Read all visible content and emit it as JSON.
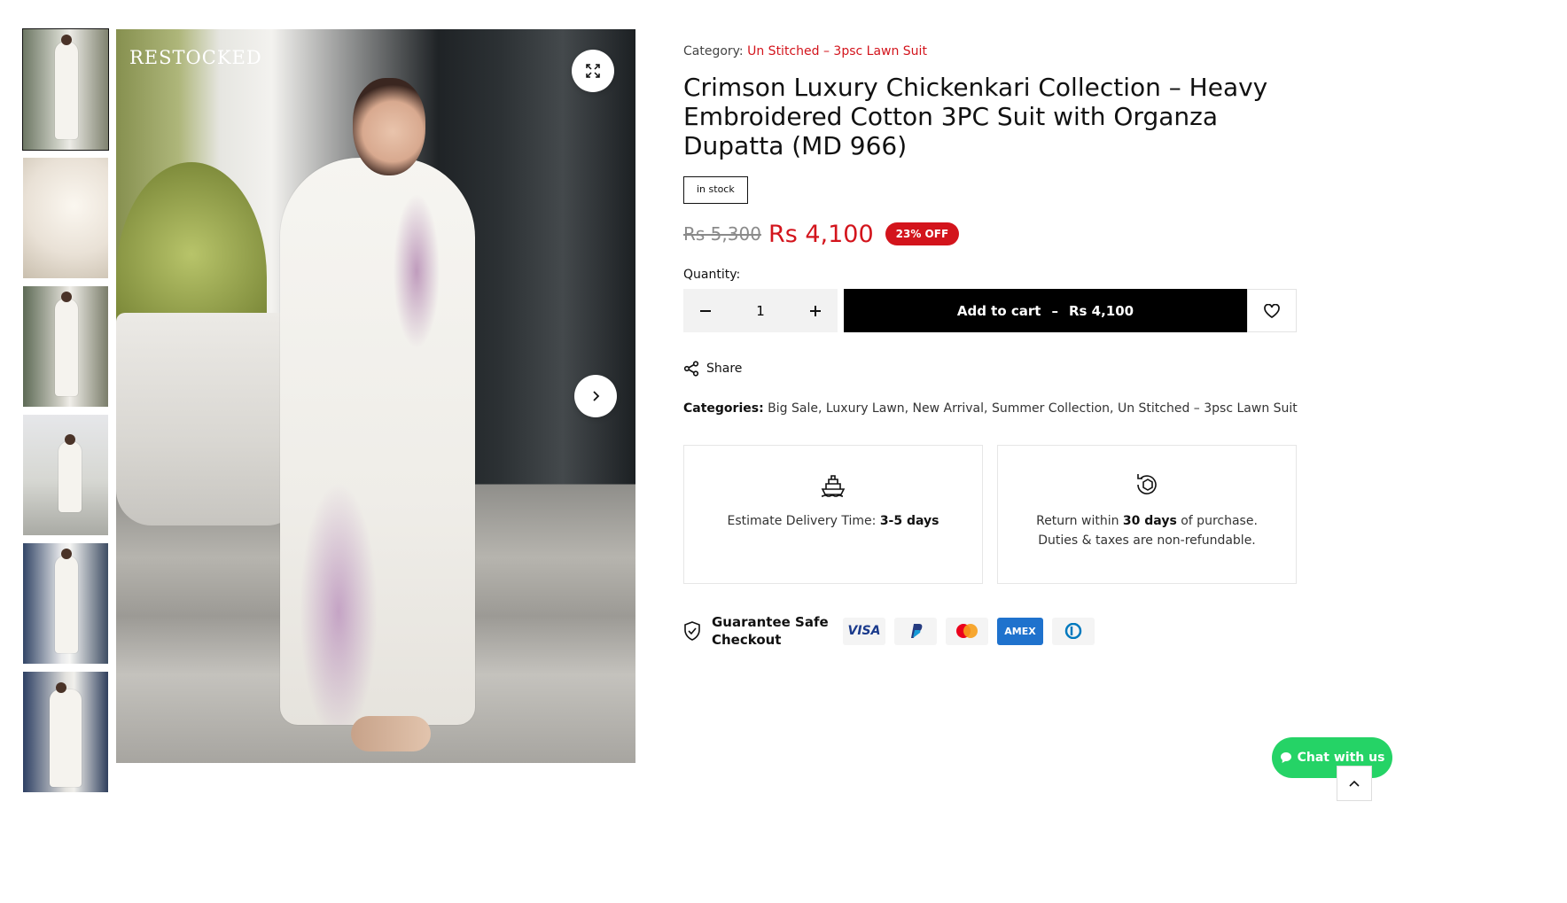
{
  "gallery": {
    "watermark": "RESTOCKED",
    "thumbnails": [
      {
        "active": true
      },
      {
        "active": false
      },
      {
        "active": false
      },
      {
        "active": false
      },
      {
        "active": false
      },
      {
        "active": false
      }
    ],
    "zoom_icon": "expand-icon",
    "next_icon": "chevron-right-icon"
  },
  "product": {
    "category_label": "Category:",
    "category_link": "Un Stitched – 3psc Lawn Suit",
    "title": "Crimson Luxury Chickenkari Collection – Heavy Embroidered Cotton 3PC Suit with Organza Dupatta (MD 966)",
    "stock": "in stock",
    "price_old": "Rs 5,300",
    "price_new": "Rs 4,100",
    "discount": "23% OFF",
    "quantity_label": "Quantity:",
    "quantity": "1",
    "add_to_cart_label": "Add to cart",
    "add_to_cart_sep": "–",
    "add_to_cart_price": "Rs 4,100",
    "share_label": "Share",
    "categories_label": "Categories:",
    "categories": [
      "Big Sale",
      "Luxury Lawn",
      "New Arrival",
      "Summer Collection",
      "Un Stitched – 3psc Lawn Suit"
    ]
  },
  "features": {
    "delivery_prefix": "Estimate Delivery Time:",
    "delivery_value": "3-5 days",
    "return_prefix": "Return within",
    "return_value": "30 days",
    "return_suffix": "of purchase. Duties & taxes are non-refundable."
  },
  "checkout": {
    "label": "Guarantee Safe Checkout",
    "payments": [
      "VISA",
      "PayPal",
      "Mastercard",
      "AMEX",
      "Diners"
    ]
  },
  "chat": {
    "label": "Chat with us"
  },
  "colors": {
    "accent": "#d3141c",
    "button": "#000000",
    "chat": "#25d366"
  }
}
